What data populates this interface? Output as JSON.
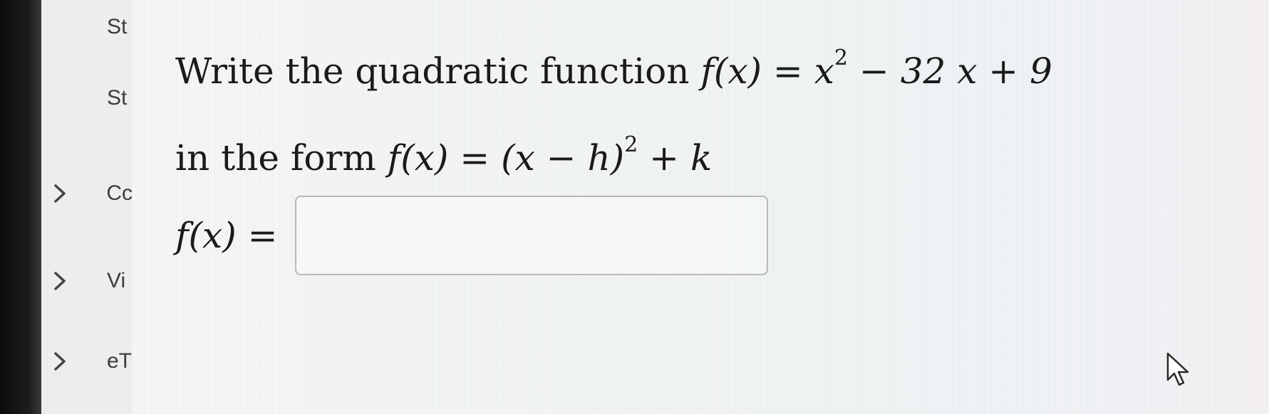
{
  "sidebar": {
    "items": [
      {
        "label": "St",
        "chevron": false
      },
      {
        "label": "St",
        "chevron": false
      },
      {
        "label": "Cc",
        "chevron": true
      },
      {
        "label": "Vi",
        "chevron": true
      },
      {
        "label": "eT",
        "chevron": true
      }
    ]
  },
  "question": {
    "line1_text": "Write the quadratic function ",
    "line1_math_lhs": "f(x) = x",
    "line1_exp": "2",
    "line1_math_rhs": " − 32 x + 9",
    "line2_text": "in the form ",
    "line2_math_lhs": "f(x) = (x − h)",
    "line2_exp": "2",
    "line2_math_rhs": " + k"
  },
  "answer": {
    "label": "f(x) =",
    "value": "",
    "placeholder": ""
  },
  "icons": {
    "chevron": "chevron-right-icon",
    "cursor": "mouse-pointer-icon"
  },
  "colors": {
    "text": "#1a1a1a",
    "input_border": "#b9b9b9",
    "sidebar_bg": "#ededeb"
  }
}
